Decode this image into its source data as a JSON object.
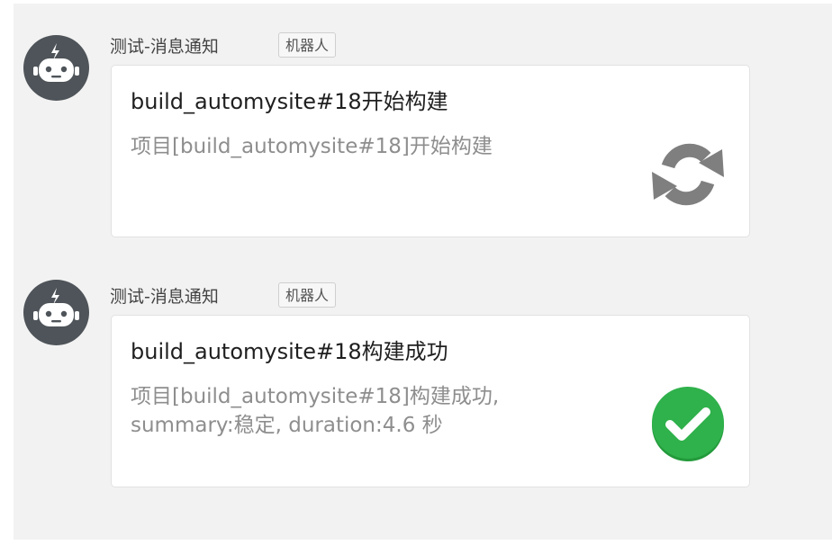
{
  "messages": [
    {
      "sender": "测试-消息通知",
      "tag": "机器人",
      "title": "build_automysite#18开始构建",
      "body_lines": [
        "项目[build_automysite#18]开始构建"
      ],
      "status_icon": "refresh-icon",
      "status_color": "#7f7f7f"
    },
    {
      "sender": "测试-消息通知",
      "tag": "机器人",
      "title": "build_automysite#18构建成功",
      "body_lines": [
        "项目[build_automysite#18]构建成功,",
        "summary:稳定, duration:4.6 秒"
      ],
      "status_icon": "check-circle-icon",
      "status_color": "#2fb14b"
    }
  ],
  "colors": {
    "panel_bg": "#f2f2f2",
    "avatar_bg": "#4e5459",
    "card_bg": "#ffffff"
  }
}
